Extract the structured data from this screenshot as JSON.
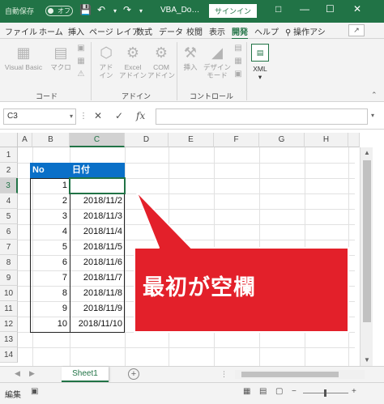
{
  "titlebar": {
    "autosave_label": "自動保存",
    "autosave_state": "オフ",
    "doc_title": "VBA_Do…",
    "signin_label": "サインイン",
    "colors": {
      "accent": "#217346"
    }
  },
  "tabs": [
    "ファイル",
    "ホーム",
    "挿入",
    "ページ レイア",
    "数式",
    "データ",
    "校閲",
    "表示",
    "開発",
    "ヘルプ"
  ],
  "active_tab_index": 8,
  "tell_me": "操作アシ",
  "ribbon": {
    "groups": {
      "code": "コード",
      "addin": "アドイン",
      "controls": "コントロール"
    },
    "buttons": {
      "visual_basic": "Visual Basic",
      "macro": "マクロ",
      "addin_line1": "アド",
      "addin_line2": "イン",
      "excel_addin_line1": "Excel",
      "excel_addin_line2": "アドイン",
      "com_addin_line1": "COM",
      "com_addin_line2": "アドイン",
      "insert": "挿入",
      "design_line1": "デザイン",
      "design_line2": "モード",
      "xml": "XML"
    }
  },
  "formula_bar": {
    "name_box": "C3",
    "fx": "fx",
    "value": ""
  },
  "grid": {
    "columns": [
      "A",
      "B",
      "C",
      "D",
      "E",
      "F",
      "G",
      "H"
    ],
    "rows": [
      "1",
      "2",
      "3",
      "4",
      "5",
      "6",
      "7",
      "8",
      "9",
      "10",
      "11",
      "12",
      "13",
      "14"
    ],
    "selected_column": "C",
    "selected_row": "3",
    "table_headers": {
      "no": "No",
      "date": "日付"
    },
    "table_rows": [
      {
        "no": "1",
        "date": ""
      },
      {
        "no": "2",
        "date": "2018/11/2"
      },
      {
        "no": "3",
        "date": "2018/11/3"
      },
      {
        "no": "4",
        "date": "2018/11/4"
      },
      {
        "no": "5",
        "date": "2018/11/5"
      },
      {
        "no": "6",
        "date": "2018/11/6"
      },
      {
        "no": "7",
        "date": "2018/11/7"
      },
      {
        "no": "8",
        "date": "2018/11/8"
      },
      {
        "no": "9",
        "date": "2018/11/9"
      },
      {
        "no": "10",
        "date": "2018/11/10"
      }
    ],
    "header_color": "#0a70c8"
  },
  "callout": {
    "text": "最初が空欄",
    "fill_color": "#e3202a"
  },
  "sheets": [
    "Sheet1"
  ],
  "status": {
    "mode": "編集"
  }
}
